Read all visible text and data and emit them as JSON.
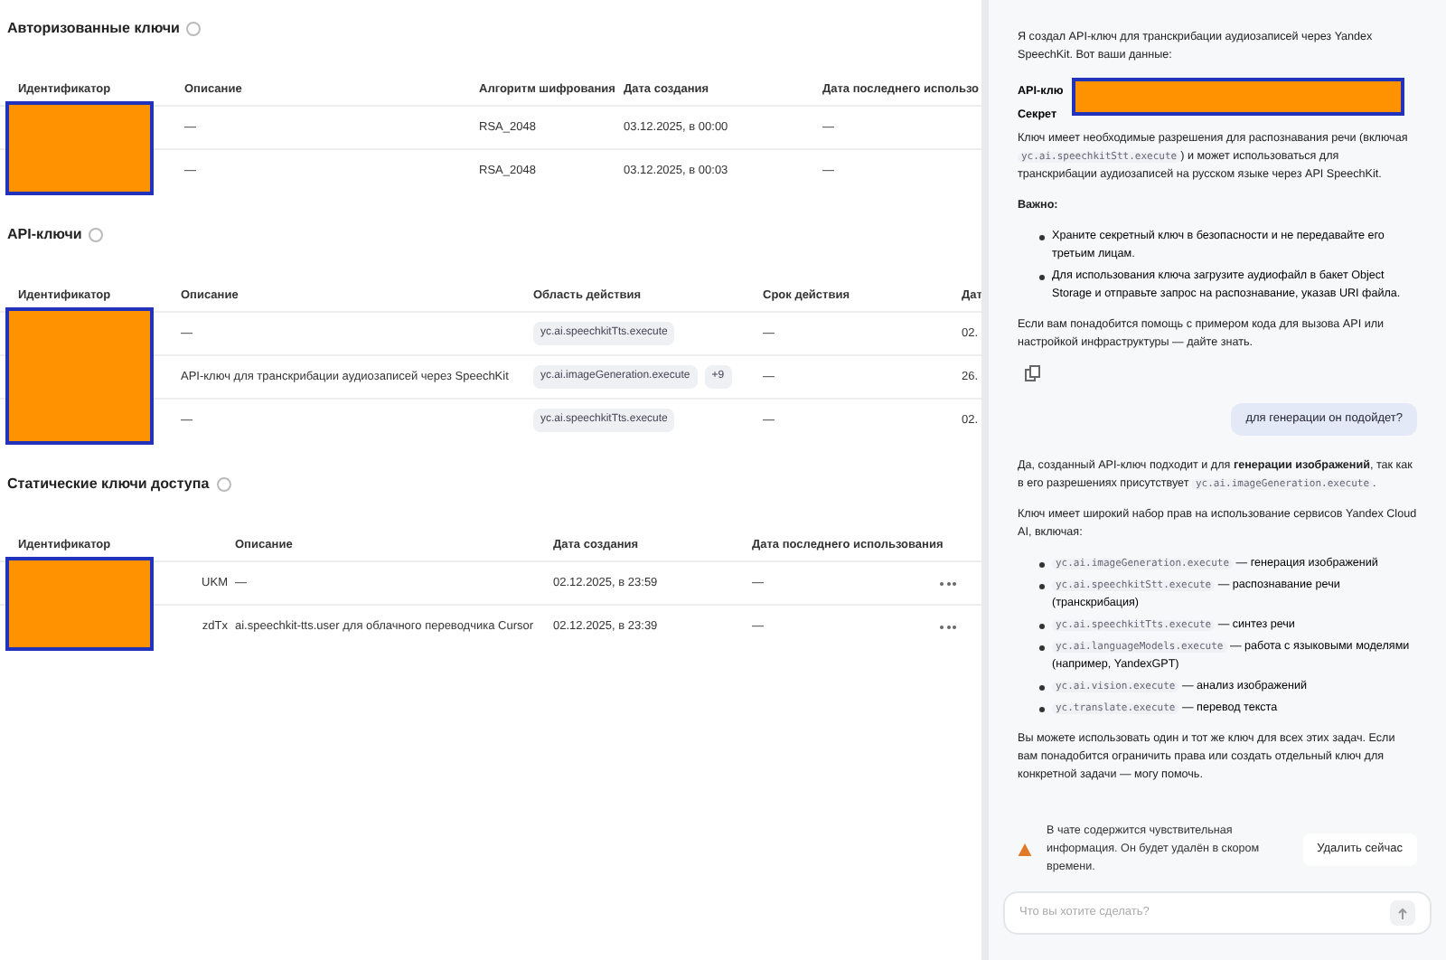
{
  "sections": [
    {
      "title": "Авторизованные ключи",
      "columns": [
        "Идентификатор",
        "Описание",
        "Алгоритм шифрования",
        "Дата создания",
        "Дата последнего использо"
      ],
      "rows": [
        {
          "cells": [
            "",
            "—",
            "RSA_2048",
            "03.12.2025, в 00:00",
            "—"
          ]
        },
        {
          "cells": [
            "",
            "—",
            "RSA_2048",
            "03.12.2025, в 00:03",
            "—"
          ]
        }
      ]
    },
    {
      "title": "API-ключи",
      "columns": [
        "Идентификатор",
        "Описание",
        "Область действия",
        "Срок действия",
        "Дат"
      ],
      "rows": [
        {
          "cells": [
            "",
            "—",
            "yc.ai.speechkitTts.execute",
            "—",
            "02."
          ],
          "extra": ""
        },
        {
          "cells": [
            "",
            "API-ключ для транскрибации аудиозаписей через SpeechKit",
            "yc.ai.imageGeneration.execute",
            "—",
            "26."
          ],
          "extra": "+9"
        },
        {
          "cells": [
            "",
            "—",
            "yc.ai.speechkitTts.execute",
            "—",
            "02."
          ],
          "extra": ""
        }
      ]
    },
    {
      "title": "Статические ключи доступа",
      "columns": [
        "Идентификатор",
        "Описание",
        "Дата создания",
        "Дата последнего использования"
      ],
      "rows": [
        {
          "cells": [
            "UKM",
            "—",
            "02.12.2025, в 23:59",
            "—"
          ]
        },
        {
          "cells": [
            "zdTx",
            "ai.speechkit-tts.user для облачного переводчика Cursor",
            "02.12.2025, в 23:39",
            "—"
          ]
        }
      ],
      "menu": true
    }
  ],
  "chat": {
    "messages": [
      {
        "kind": "assistant",
        "blocks": [
          {
            "kind": "p",
            "parts": [
              {
                "kind": "text",
                "text": "Я создал API-ключ для транскрибации аудиозаписей через Yandex SpeechKit. Вот ваши данные:"
              }
            ]
          },
          {
            "kind": "secret",
            "lines": [
              "API-клю",
              "Секрет"
            ]
          },
          {
            "kind": "p",
            "parts": [
              {
                "kind": "text",
                "text": "Ключ имеет необходимые разрешения для распознавания речи (включая "
              },
              {
                "kind": "code",
                "text": "yc.ai.speechkitStt.execute"
              },
              {
                "kind": "text",
                "text": ") и может использоваться для транскрибации аудиозаписей на русском языке через API SpeechKit."
              }
            ]
          },
          {
            "kind": "p",
            "parts": [
              {
                "kind": "text",
                "text": "**Важно:**"
              }
            ]
          },
          {
            "kind": "list",
            "items": [
              {
                "text": "Храните секретный ключ в безопасности и не передавайте его третьим лицам."
              },
              {
                "text": "Для использования ключа загрузите аудиофайл в бакет Object Storage и отправьте запрос на распознавание, указав URI файла."
              }
            ]
          },
          {
            "kind": "p",
            "parts": [
              {
                "kind": "text",
                "text": "Если вам понадобится помощь с примером кода для вызова API или настройкой инфраструктуры — дайте знать."
              }
            ]
          },
          {
            "kind": "copy"
          }
        ]
      },
      {
        "kind": "user",
        "text": "для генерации он подойдет?"
      },
      {
        "kind": "assistant",
        "blocks": [
          {
            "kind": "p",
            "parts": [
              {
                "kind": "text",
                "text": "Да, созданный API-ключ подходит и для **генерации изображений**, так как в его разрешениях присутствует "
              },
              {
                "kind": "code",
                "text": "yc.ai.imageGeneration.execute"
              },
              {
                "kind": "text",
                "text": "."
              }
            ]
          },
          {
            "kind": "p",
            "parts": [
              {
                "kind": "text",
                "text": "Ключ имеет широкий набор прав на использование сервисов Yandex Cloud AI, включая:"
              }
            ]
          },
          {
            "kind": "list",
            "items": [
              {
                "code": "yc.ai.imageGeneration.execute",
                "text": "— генерация изображений"
              },
              {
                "code": "yc.ai.speechkitStt.execute",
                "text": "— распознавание речи (транскрибация)"
              },
              {
                "code": "yc.ai.speechkitTts.execute",
                "text": "— синтез речи"
              },
              {
                "code": "yc.ai.languageModels.execute",
                "text": "— работа с языковыми моделями (например, YandexGPT)"
              },
              {
                "code": "yc.ai.vision.execute",
                "text": "— анализ изображений"
              },
              {
                "code": "yc.translate.execute",
                "text": "— перевод текста"
              }
            ]
          },
          {
            "kind": "p",
            "parts": [
              {
                "kind": "text",
                "text": "Вы можете использовать один и тот же ключ для всех этих задач. Если вам понадобится ограничить права или создать отдельный ключ для конкретной задачи — могу помочь."
              }
            ]
          }
        ]
      }
    ],
    "warning": {
      "text": "В чате содержится чувствительная информация. Он будет удалён в скором времени.",
      "button": "Удалить сейчас"
    },
    "input": {
      "placeholder": "Что вы хотите сделать?"
    }
  }
}
